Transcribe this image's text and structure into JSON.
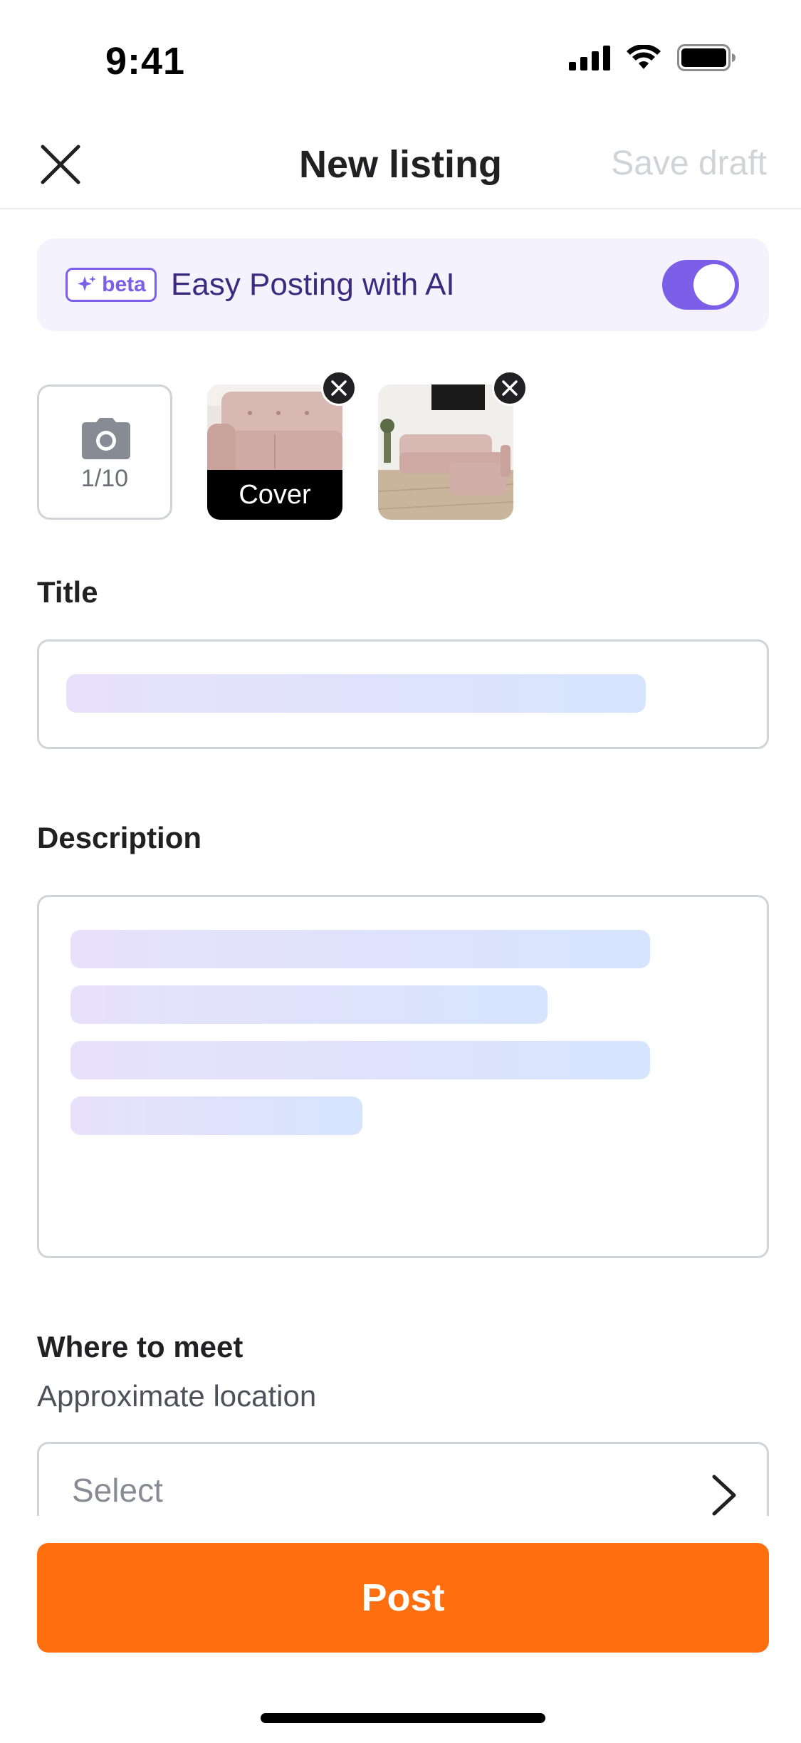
{
  "status_bar": {
    "time": "9:41",
    "icons": [
      "cellular-signal-icon",
      "wifi-icon",
      "battery-icon"
    ]
  },
  "header": {
    "title": "New listing",
    "save_draft_label": "Save draft",
    "close_icon": "close-icon"
  },
  "ai_banner": {
    "badge_label": "beta",
    "label": "Easy Posting with AI",
    "toggle_on": true
  },
  "photos": {
    "count_label": "1/10",
    "add_icon": "camera-icon",
    "cover_label": "Cover"
  },
  "form": {
    "title_label": "Title",
    "description_label": "Description",
    "location_label": "Where to meet",
    "location_sublabel": "Approximate location",
    "location_placeholder": "Select"
  },
  "footer": {
    "post_label": "Post"
  },
  "colors": {
    "accent_orange": "#ff6f0f",
    "ai_purple": "#7b5fe8",
    "banner_bg": "#f4f2fd",
    "disabled_text": "#d1d3d8"
  }
}
